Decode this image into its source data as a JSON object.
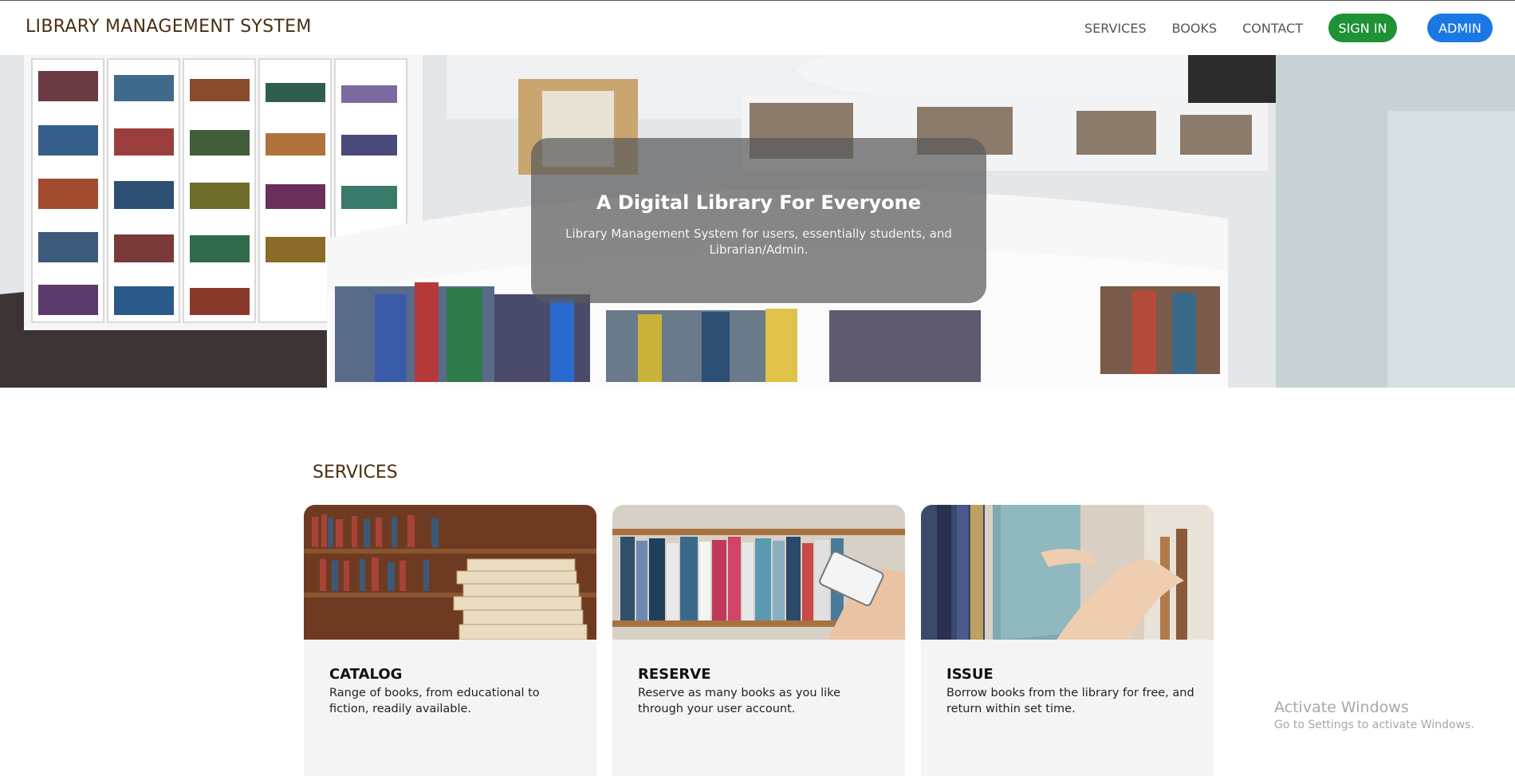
{
  "brand": "LIBRARY MANAGEMENT SYSTEM",
  "nav": {
    "links": [
      "SERVICES",
      "BOOKS",
      "CONTACT"
    ],
    "signin_label": "SIGN IN",
    "admin_label": "ADMIN"
  },
  "hero": {
    "title": "A Digital Library For Everyone",
    "subtitle": "Library Management System for users, essentially students, and Librarian/Admin."
  },
  "services": {
    "heading": "SERVICES",
    "cards": [
      {
        "title": "CATALOG",
        "description": "Range of books, from educational to fiction, readily available."
      },
      {
        "title": "RESERVE",
        "description": "Reserve as many books as you like through your user account."
      },
      {
        "title": "ISSUE",
        "description": "Borrow books from the library for free, and return within set time."
      }
    ]
  },
  "watermark": {
    "title": "Activate Windows",
    "subtitle": "Go to Settings to activate Windows."
  },
  "colors": {
    "brand_text": "#4b2f12",
    "signin_button": "#1f9236",
    "admin_button": "#1a78e5",
    "card_background": "#f4f4f4"
  }
}
